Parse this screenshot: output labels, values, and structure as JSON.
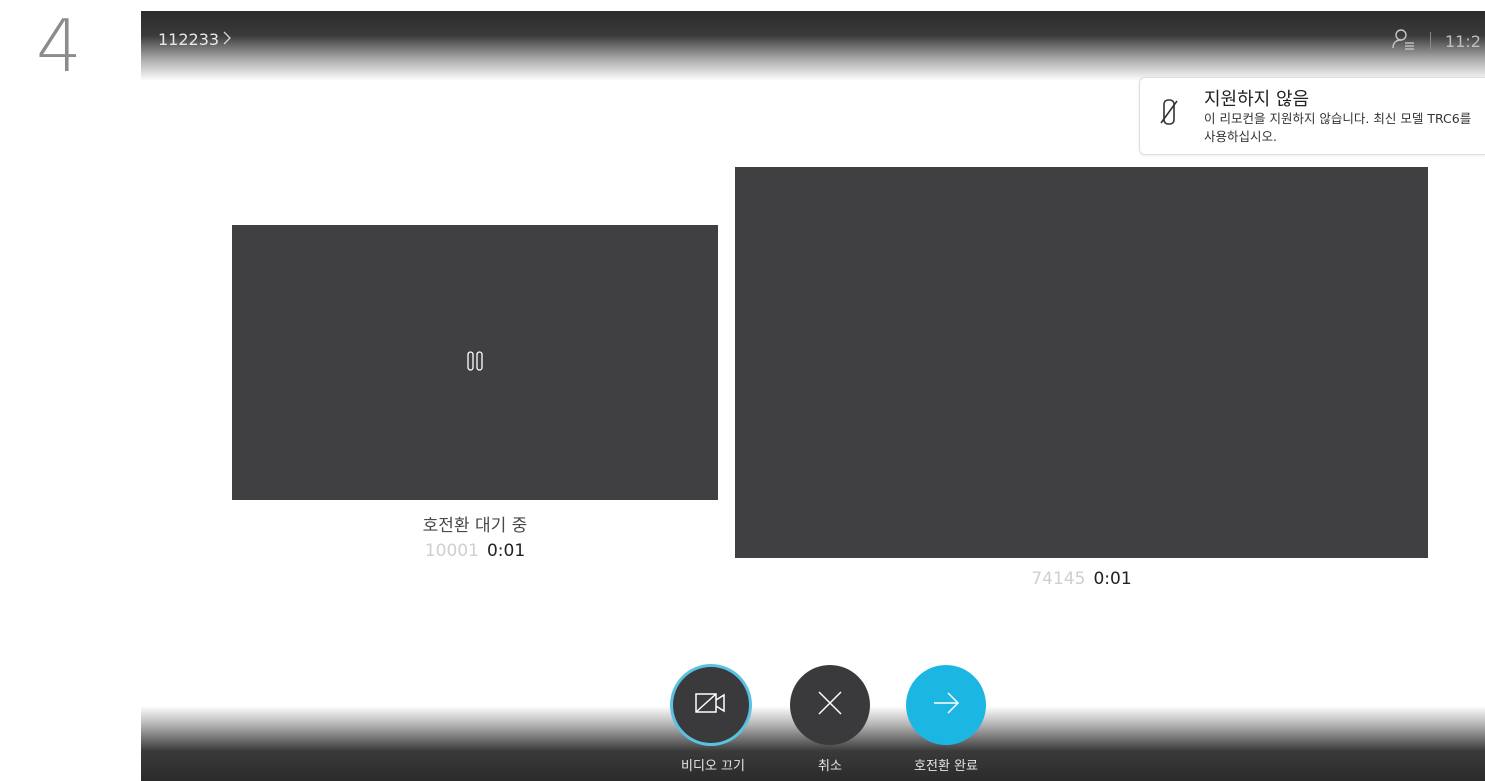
{
  "step_number": "4",
  "header": {
    "breadcrumb": "112233",
    "breadcrumb_chevron": "chevron-right-icon",
    "contacts_icon": "person-list-icon",
    "clock": "11:2"
  },
  "toast": {
    "icon": "remote-unsupported-icon",
    "title": "지원하지 않음",
    "body": "이 리모컨을 지원하지 않습니다. 최신 모델 TRC6를 사용하십시오."
  },
  "calls": {
    "held": {
      "status": "호전환 대기 중",
      "number": "10001",
      "duration": "0:01",
      "icon": "pause-icon"
    },
    "active": {
      "number": "74145",
      "duration": "0:01"
    }
  },
  "controls": {
    "video_off": {
      "label": "비디오 끄기",
      "icon": "video-off-icon"
    },
    "cancel": {
      "label": "취소",
      "icon": "close-icon"
    },
    "complete": {
      "label": "호전환 완료",
      "icon": "arrow-right-icon"
    }
  },
  "colors": {
    "tile_background": "#404043",
    "complete_button": "#1cb6e3",
    "dark_button": "#3a3a3c",
    "focus_ring": "#59c2e0"
  }
}
